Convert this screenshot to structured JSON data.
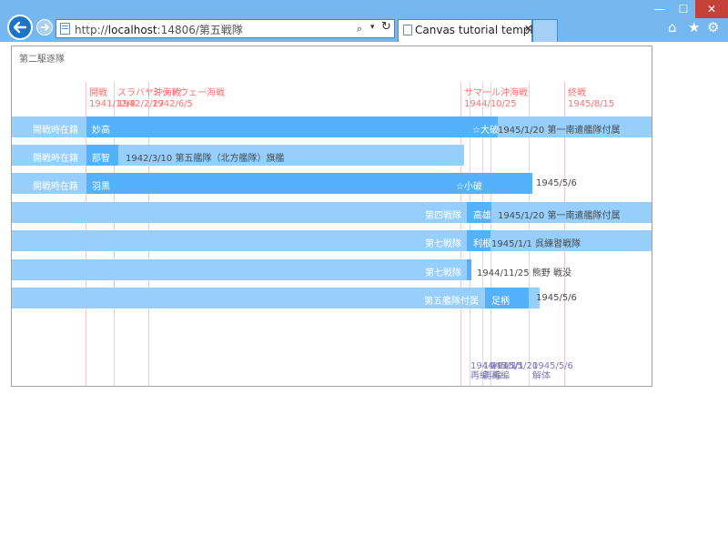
{
  "browser": {
    "url_prefix": "http://",
    "url_host": "localhost",
    "url_rest": ":14806/第五戦隊",
    "tab_title": "Canvas tutorial template",
    "controls": {
      "minimize": "—",
      "maximize": "☐",
      "close": "✕",
      "search": "⌕",
      "dropdown": "▾",
      "refresh": "↻",
      "tab_close": "✕"
    },
    "icons": {
      "back": "back-arrow-icon",
      "forward": "forward-arrow-icon",
      "home": "home-icon",
      "favorites": "star-icon",
      "settings": "gear-icon"
    },
    "accent": "#1c74c5",
    "close_color": "#c7413b"
  },
  "chart": {
    "title": "第二駆逐隊",
    "events": [
      {
        "name": "開戦",
        "date": "1941/12/8"
      },
      {
        "name": "スラバヤ沖海戦",
        "date": "1942/2/27"
      },
      {
        "name": "ミッドウェー海戦",
        "date": "1942/6/5"
      },
      {
        "name": "サマール沖海戦",
        "date": "1944/10/25"
      },
      {
        "name": "終戦",
        "date": "1945/8/15"
      }
    ],
    "bottom_events": [
      {
        "date": "1944/11/15",
        "name": "再編"
      },
      {
        "date": "1945/1/1",
        "name": "再編"
      },
      {
        "date": "1945/1/20",
        "name": "再編"
      },
      {
        "date": "1945/5/6",
        "name": "解体"
      }
    ],
    "rows": [
      {
        "left": "開戦時在籍",
        "ship": "妙高",
        "marker": "☆大破",
        "note": "1945/1/20 第一南遣艦隊付属"
      },
      {
        "left": "開戦時在籍",
        "ship": "那智",
        "note": "1942/3/10 第五艦隊（北方艦隊）旗艦"
      },
      {
        "left": "開戦時在籍",
        "ship": "羽黒",
        "marker": "☆小破",
        "note": "1945/5/6"
      },
      {
        "left": "第四戦隊",
        "ship": "高雄",
        "note": "1945/1/20 第一南遣艦隊付属"
      },
      {
        "left": "第七戦隊",
        "ship": "利根",
        "note": "1945/1/1 呉練習戦隊"
      },
      {
        "left": "第七戦隊",
        "note": "1944/11/25 熊野 戦没"
      },
      {
        "left": "第五艦隊付属",
        "ship": "足柄",
        "note": "1945/5/6"
      }
    ],
    "colors": {
      "bar_light": "#96cffb",
      "bar_dark": "#56b1fb",
      "event": "#ff6f6f",
      "bottom_event": "#7d79bb"
    }
  }
}
